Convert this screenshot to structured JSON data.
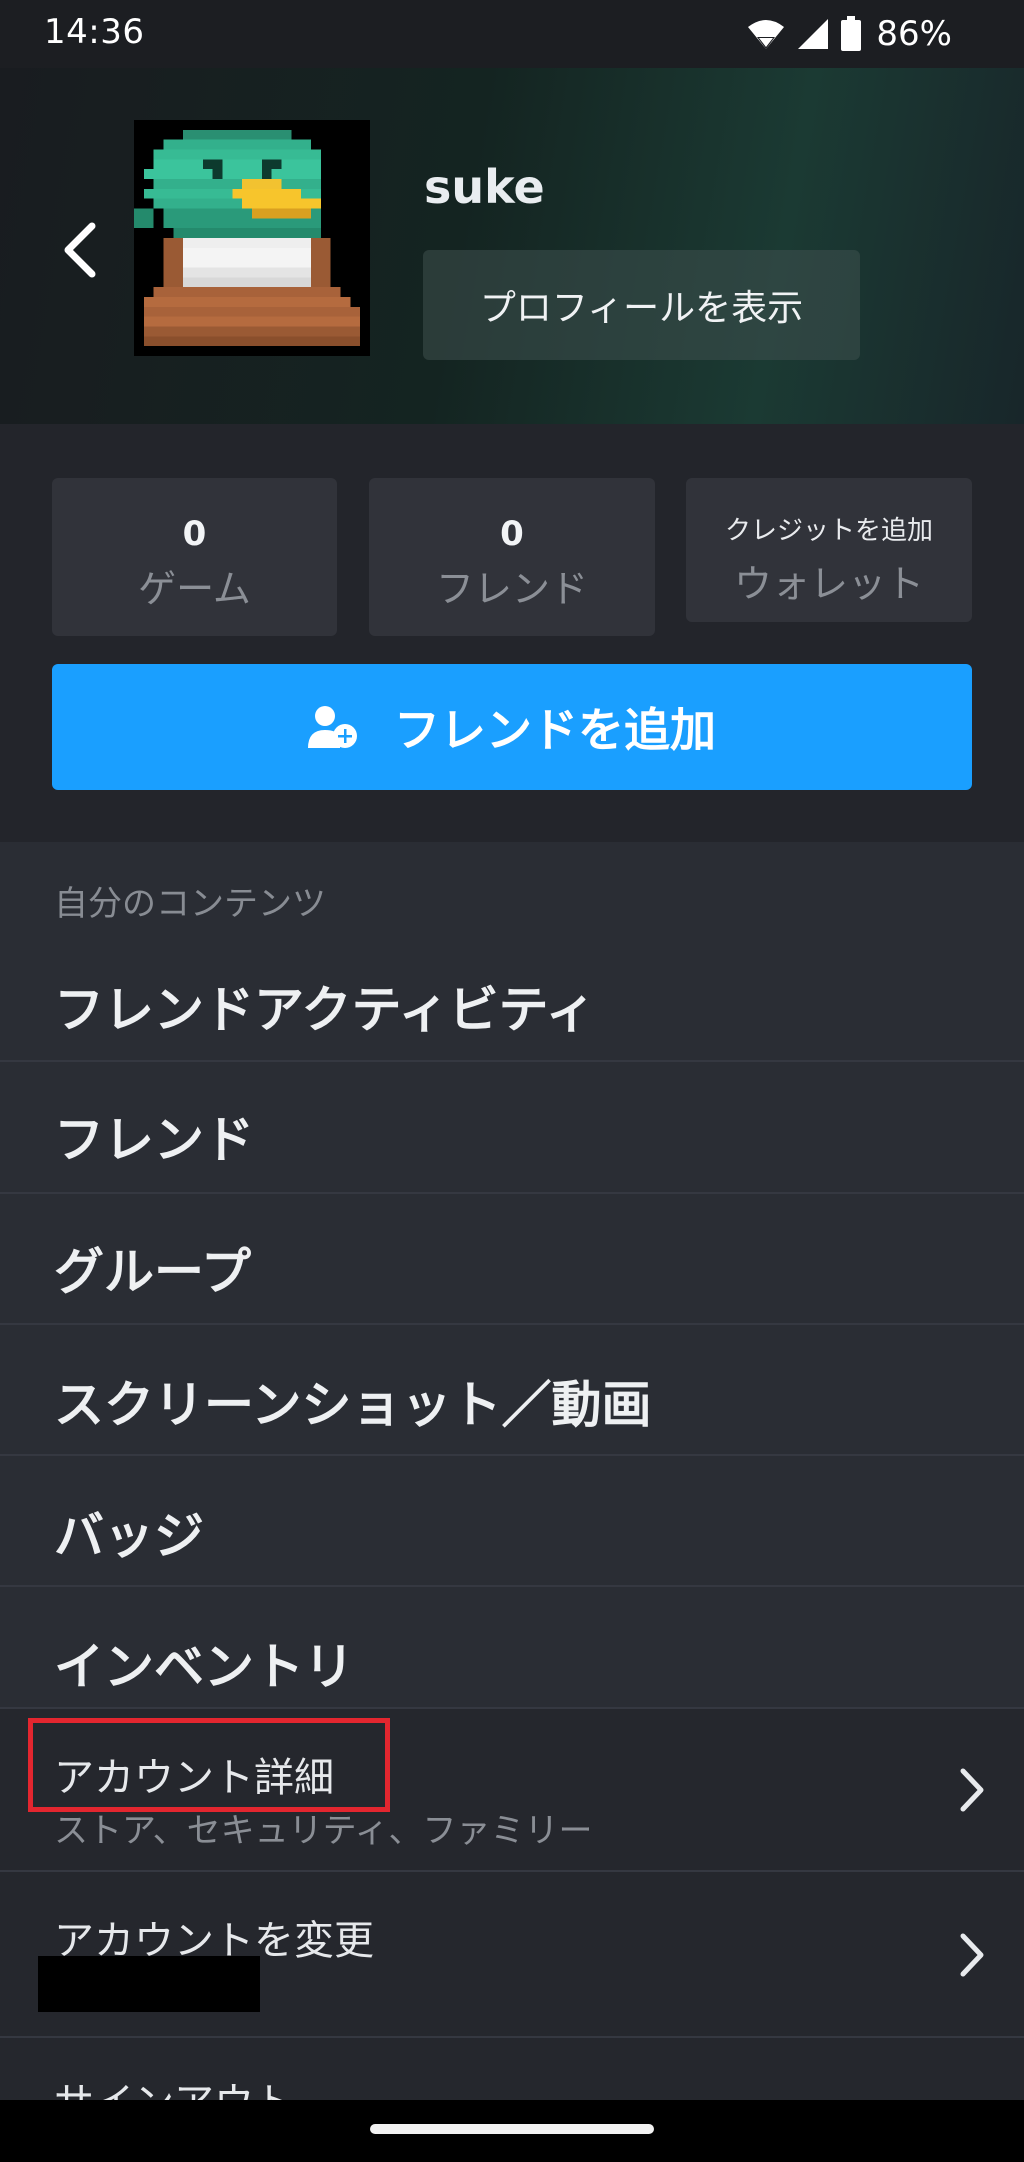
{
  "status_bar": {
    "time": "14:36",
    "battery_percent": "86%",
    "icons": [
      "wifi-icon",
      "signal-icon",
      "battery-icon"
    ]
  },
  "profile": {
    "username": "suke",
    "view_profile_label": "プロフィールを表示",
    "back_icon": "chevron-left-icon"
  },
  "stats": {
    "games": {
      "count": "0",
      "label": "ゲーム"
    },
    "friends": {
      "count": "0",
      "label": "フレンド"
    },
    "wallet": {
      "action": "クレジットを追加",
      "label": "ウォレット"
    }
  },
  "add_friend": {
    "label": "フレンドを追加",
    "icon": "add-user-icon"
  },
  "menu": {
    "section_title": "自分のコンテンツ",
    "items": [
      {
        "label": "フレンドアクティビティ"
      },
      {
        "label": "フレンド"
      },
      {
        "label": "グループ"
      },
      {
        "label": "スクリーンショット／動画"
      },
      {
        "label": "バッジ"
      },
      {
        "label": "インベントリ"
      }
    ],
    "account_details": {
      "title": "アカウント詳細",
      "subtitle": "ストア、セキュリティ、ファミリー"
    },
    "change_account": {
      "title": "アカウントを変更"
    },
    "sign_out": {
      "title": "サインアウト"
    }
  },
  "colors": {
    "accent": "#1a9fff",
    "highlight": "#e3262f",
    "background": "#2a2d34"
  }
}
